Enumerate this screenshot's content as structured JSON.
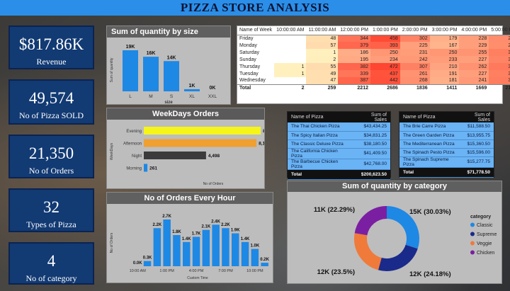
{
  "title": "PIZZA STORE ANALYSIS",
  "kpis": [
    {
      "value": "$817.86K",
      "label": "Revenue"
    },
    {
      "value": "49,574",
      "label": "No of Pizza SOLD"
    },
    {
      "value": "21,350",
      "label": "No of Orders"
    },
    {
      "value": "32",
      "label": "Types of Pizza"
    },
    {
      "value": "4",
      "label": "No of category"
    }
  ],
  "chart_data": [
    {
      "id": "size",
      "type": "bar",
      "title": "Sum of quantity by size",
      "xlabel": "size",
      "ylabel": "Sum of quantity",
      "categories": [
        "L",
        "M",
        "S",
        "XL",
        "XXL"
      ],
      "values": [
        19,
        16,
        14,
        1,
        0
      ],
      "labels": [
        "19K",
        "16K",
        "14K",
        "1K",
        "0K"
      ],
      "color": "#1e88e5"
    },
    {
      "id": "weekdays",
      "type": "bar",
      "title": "WeekDays Orders",
      "xlabel": "No of Orders",
      "ylabel": "WeekDays",
      "categories": [
        "Evening",
        "Afternoon",
        "Night",
        "Morning"
      ],
      "values": [
        8446,
        8145,
        4498,
        261
      ],
      "labels": [
        "8,446",
        "8,145",
        "4,498",
        "261"
      ],
      "colors": [
        "#f5f51a",
        "#f0a030",
        "#3b3b3b",
        "#1e88e5"
      ]
    },
    {
      "id": "hourly",
      "type": "bar",
      "title": "No of Orders Every Hour",
      "xlabel": "Custom Time",
      "ylabel": "No of Orders",
      "tick_labels": [
        "10:00 AM",
        "1:00 PM",
        "4:00 PM",
        "7:00 PM",
        "10:00 PM"
      ],
      "values": [
        0.0,
        0.3,
        2.2,
        2.7,
        1.8,
        1.4,
        1.7,
        2.1,
        2.4,
        2.2,
        1.9,
        1.4,
        1.0,
        0.2
      ],
      "labels": [
        "0.0K",
        "0.3K",
        "2.2K",
        "2.7K",
        "1.8K",
        "1.4K",
        "1.7K",
        "2.1K",
        "2.4K",
        "2.2K",
        "1.9K",
        "1.4K",
        "1.0K",
        "0.2K"
      ],
      "color": "#1e88e5"
    },
    {
      "id": "category",
      "type": "pie",
      "title": "Sum of quantity by category",
      "legend_title": "category",
      "legend_position": "right",
      "slices": [
        {
          "name": "Classic",
          "value": 30.03,
          "label": "15K (30.03%)",
          "color": "#1e88e5"
        },
        {
          "name": "Supreme",
          "value": 24.18,
          "label": "12K (24.18%)",
          "color": "#1a2a8a"
        },
        {
          "name": "Veggie",
          "value": 23.5,
          "label": "12K (23.5%)",
          "color": "#f07a3a"
        },
        {
          "name": "Chicken",
          "value": 22.29,
          "label": "11K (22.29%)",
          "color": "#7b1fa2"
        }
      ]
    }
  ],
  "heatmap": {
    "columns": [
      "Name of Week",
      "10:00:00 AM",
      "11:00:00 AM",
      "12:00:00 PM",
      "1:00:00 PM",
      "2:00:00 PM",
      "3:00:00 PM",
      "4:00:00 PM",
      "5:00:00 PM"
    ],
    "rows": [
      {
        "name": "Friday",
        "cells": [
          "",
          "48",
          "344",
          "458",
          "302",
          "179",
          "228",
          "278"
        ]
      },
      {
        "name": "Monday",
        "cells": [
          "",
          "57",
          "379",
          "393",
          "225",
          "167",
          "229",
          "273"
        ]
      },
      {
        "name": "Saturday",
        "cells": [
          "",
          "1",
          "186",
          "250",
          "231",
          "250",
          "255",
          "313"
        ]
      },
      {
        "name": "Sunday",
        "cells": [
          "",
          "2",
          "195",
          "234",
          "242",
          "233",
          "227",
          "301"
        ]
      },
      {
        "name": "Thursday",
        "cells": [
          "1",
          "55",
          "382",
          "472",
          "307",
          "210",
          "262",
          "331"
        ]
      },
      {
        "name": "Tuesday",
        "cells": [
          "1",
          "49",
          "339",
          "437",
          "261",
          "191",
          "227",
          "315"
        ]
      },
      {
        "name": "Wednesday",
        "cells": [
          "",
          "47",
          "387",
          "442",
          "268",
          "181",
          "241",
          "319"
        ]
      }
    ],
    "total": {
      "name": "Total",
      "cells": [
        "2",
        "259",
        "2212",
        "2686",
        "1836",
        "1411",
        "1669",
        "2130"
      ]
    }
  },
  "sales_left": {
    "headers": [
      "Name of Pizza",
      "Sum of Sales"
    ],
    "rows": [
      [
        "The Thai Chicken Pizza",
        "$43,434.25"
      ],
      [
        "The Spicy Italian Pizza",
        "$34,831.25"
      ],
      [
        "The Classic Deluxe Pizza",
        "$38,180.50"
      ],
      [
        "The California Chicken Pizza",
        "$41,409.50"
      ],
      [
        "The Barbecue Chicken Pizza",
        "$42,768.00"
      ]
    ],
    "total": [
      "Total",
      "$200,623.50"
    ]
  },
  "sales_right": {
    "headers": [
      "Name of Pizza",
      "Sum of Sales"
    ],
    "rows": [
      [
        "The Brie Carre Pizza",
        "$11,588.50"
      ],
      [
        "The Green Garden Pizza",
        "$13,955.75"
      ],
      [
        "The Mediterranean Pizza",
        "$15,360.50"
      ],
      [
        "The Spinach Pesto Pizza",
        "$15,596.00"
      ],
      [
        "The Spinach Supreme Pizza",
        "$15,277.75"
      ]
    ],
    "total": [
      "Total",
      "$71,778.50"
    ]
  }
}
